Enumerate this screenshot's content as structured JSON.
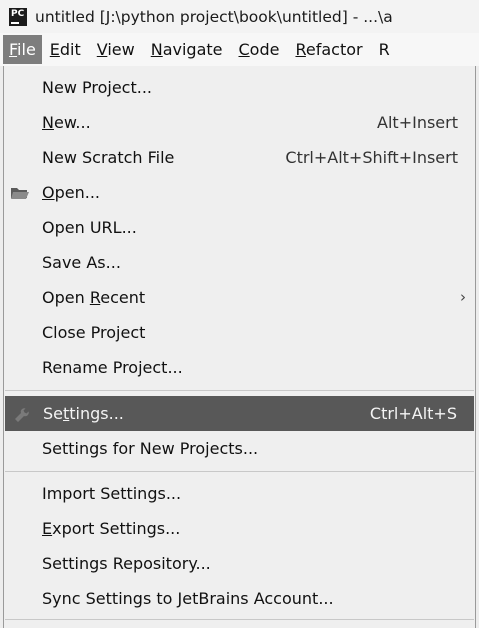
{
  "window": {
    "icon_label": "PC",
    "title": "untitled [J:\\python project\\book\\untitled] - ...\\a"
  },
  "menubar": {
    "items": [
      {
        "label": "File",
        "mnemonic": "F",
        "active": true
      },
      {
        "label": "Edit",
        "mnemonic": "E"
      },
      {
        "label": "View",
        "mnemonic": "V"
      },
      {
        "label": "Navigate",
        "mnemonic": "N"
      },
      {
        "label": "Code",
        "mnemonic": "C"
      },
      {
        "label": "Refactor",
        "mnemonic": "R"
      },
      {
        "label": "R",
        "mnemonic": ""
      }
    ]
  },
  "file_menu": {
    "items": [
      {
        "label": "New Project...",
        "shortcut": ""
      },
      {
        "label": "New...",
        "shortcut": "Alt+Insert"
      },
      {
        "label": "New Scratch File",
        "shortcut": "Ctrl+Alt+Shift+Insert"
      },
      {
        "label": "Open...",
        "shortcut": "",
        "icon": "folder-icon"
      },
      {
        "label": "Open URL...",
        "shortcut": ""
      },
      {
        "label": "Save As...",
        "shortcut": ""
      },
      {
        "label": "Open Recent",
        "shortcut": "",
        "submenu": true
      },
      {
        "label": "Close Project",
        "shortcut": ""
      },
      {
        "label": "Rename Project...",
        "shortcut": ""
      },
      {
        "label": "Settings...",
        "shortcut": "Ctrl+Alt+S",
        "icon": "wrench-icon",
        "highlighted": true
      },
      {
        "label": "Settings for New Projects...",
        "shortcut": ""
      },
      {
        "label": "Import Settings...",
        "shortcut": ""
      },
      {
        "label": "Export Settings...",
        "shortcut": ""
      },
      {
        "label": "Settings Repository...",
        "shortcut": ""
      },
      {
        "label": "Sync Settings to JetBrains Account...",
        "shortcut": ""
      }
    ],
    "submenu_arrow": "›"
  },
  "colors": {
    "highlight_bg": "#585858",
    "active_menu_bg": "#7d7d7d",
    "menu_bg": "#efefef"
  }
}
